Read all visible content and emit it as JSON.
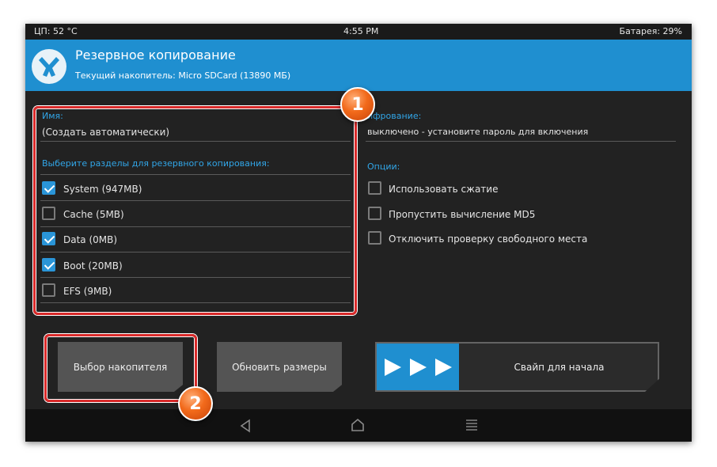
{
  "status_bar": {
    "cpu": "ЦП: 52 °C",
    "time": "4:55 PM",
    "battery": "Батарея: 29%"
  },
  "header": {
    "title": "Резервное копирование",
    "subtitle": "Текущий накопитель: Micro SDCard (13890 МБ)",
    "logo_icon": "twrp-logo-icon"
  },
  "name_section": {
    "label": "Имя:",
    "value": "(Создать автоматически)"
  },
  "partitions": {
    "label": "Выберите разделы для резервного копирования:",
    "items": [
      {
        "label": "System (947MB)",
        "checked": true
      },
      {
        "label": "Cache (5MB)",
        "checked": false
      },
      {
        "label": "Data (0MB)",
        "checked": true
      },
      {
        "label": "Boot (20MB)",
        "checked": true
      },
      {
        "label": "EFS (9MB)",
        "checked": false
      }
    ]
  },
  "encryption": {
    "label": "ифрование:",
    "value": "выключено - установите пароль для включения"
  },
  "options": {
    "label": "Опции:",
    "items": [
      {
        "label": "Использовать сжатие",
        "checked": false
      },
      {
        "label": "Пропустить вычисление MD5",
        "checked": false
      },
      {
        "label": "Отключить проверку свободного места",
        "checked": false
      }
    ]
  },
  "buttons": {
    "select_storage": "Выбор накопителя",
    "refresh_sizes": "Обновить размеры"
  },
  "swipe": {
    "label": "Свайп для начала",
    "icon": "triple-arrow-icon"
  },
  "nav": {
    "back_icon": "back-icon",
    "home_icon": "home-icon",
    "menu_icon": "menu-icon"
  },
  "annotations": {
    "badge1": "1",
    "badge2": "2"
  },
  "colors": {
    "accent": "#1f8fd0",
    "label_blue": "#31a6e8",
    "background": "#222222",
    "highlight_red": "#d92a2a",
    "badge_orange": "#f26a1b"
  }
}
